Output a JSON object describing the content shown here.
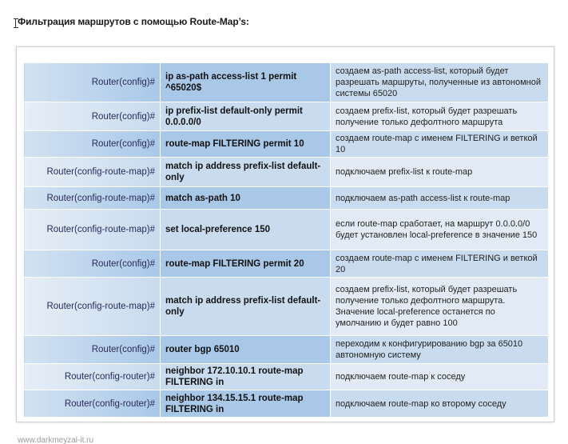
{
  "page": {
    "title": "Фильтрация маршрутов с помощью Route-Map’s:",
    "footer_url": "www.darkmeyzal-it.ru"
  },
  "colors": {
    "cell_blue_dark": "#a9c8e8",
    "cell_blue_light": "#c9dcef",
    "cell_blue_alt": "#e2ebf5"
  },
  "table": {
    "rows": [
      {
        "prompt": "Router(config)#",
        "command": "ip as-path access-list 1 permit ^65020$",
        "description": "создаем as-path access-list, который будет разрешать маршруты, полученные из автономной системы 65020"
      },
      {
        "prompt": "Router(config)#",
        "command": "ip prefix-list default-only permit 0.0.0.0/0",
        "description": "создаем prefix-list, который будет разрешать получение только дефолтного маршрута"
      },
      {
        "prompt": "Router(config)#",
        "command": "route-map FILTERING permit 10",
        "description": "создаем route-map с именем FILTERING и веткой 10"
      },
      {
        "prompt": "Router(config-route-map)#",
        "command": "match ip address prefix-list default-only",
        "description": "подключаем prefix-list к route-map"
      },
      {
        "prompt": "Router(config-route-map)#",
        "command": "match as-path 10",
        "description": "подключаем as-path access-list к route-map"
      },
      {
        "prompt": "Router(config-route-map)#",
        "command": "set local-preference 150",
        "description": "если route-map сработает, на маршрут 0.0.0.0/0 будет установлен local-preference в значение 150"
      },
      {
        "prompt": "Router(config)#",
        "command": "route-map FILTERING permit 20",
        "description": "создаем route-map с именем FILTERING и веткой 20"
      },
      {
        "prompt": "Router(config-route-map)#",
        "command": "match ip address prefix-list default-only",
        "description": "создаем prefix-list, который будет разрешать получение только дефолтного маршрута. Значение local-preference останется по умолчанию и будет равно 100"
      },
      {
        "prompt": "Router(config)#",
        "command": "router bgp 65010",
        "description": "переходим к конфигурированию bgp за 65010 автономную систему"
      },
      {
        "prompt": "Router(config-router)#",
        "command": "neighbor 172.10.10.1 route-map FILTERING in",
        "description": "подключаем route-map к соседу"
      },
      {
        "prompt": "Router(config-router)#",
        "command": "neighbor 134.15.15.1 route-map FILTERING in",
        "description": "подключаем route-map ко второму соседу"
      }
    ]
  }
}
